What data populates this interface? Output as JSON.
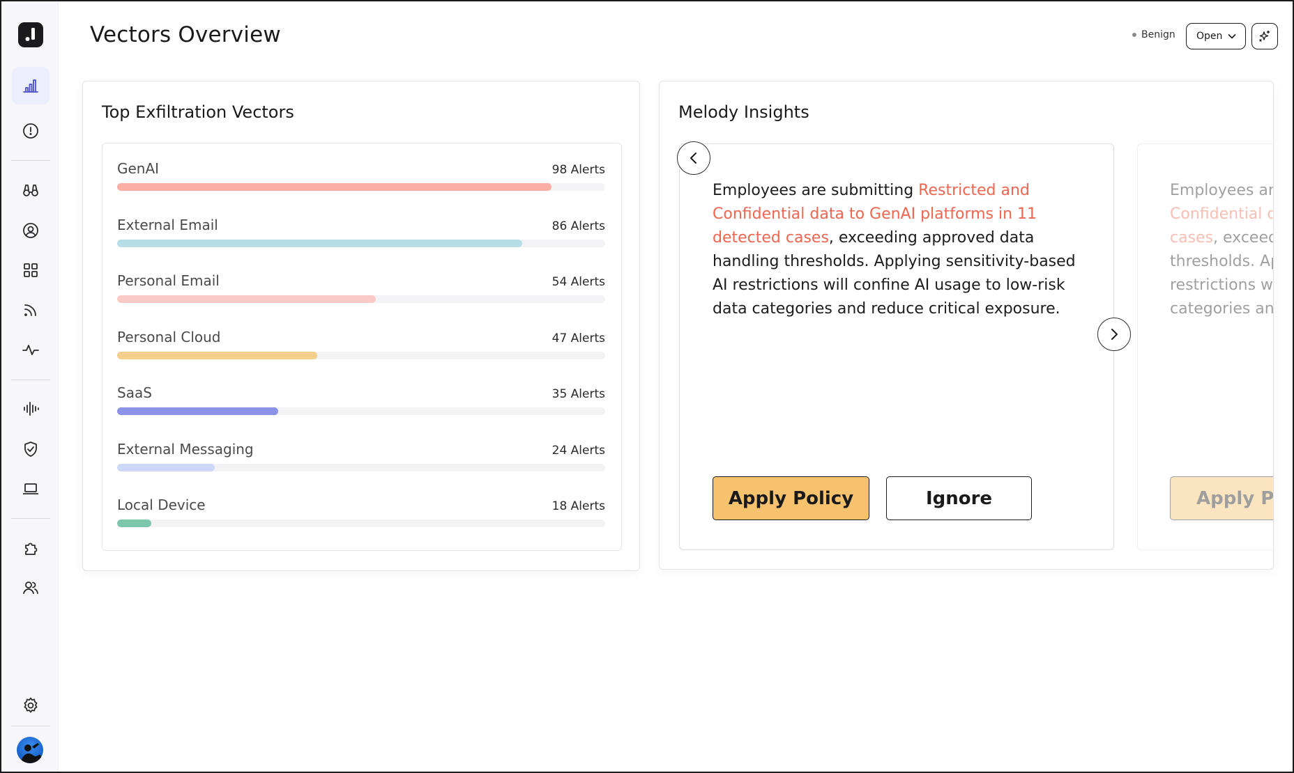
{
  "header": {
    "title": "Vectors Overview",
    "status_label": "Benign",
    "status_dot_color": "#8a8a8a",
    "open_select_value": "Open"
  },
  "sidebar": {
    "items": [
      {
        "icon": "bar-chart-icon",
        "active": true
      },
      {
        "icon": "alert-circle-icon",
        "active": false
      },
      {
        "icon": "binoculars-icon",
        "active": false
      },
      {
        "icon": "user-circle-icon",
        "active": false
      },
      {
        "icon": "grid-icon",
        "active": false
      },
      {
        "icon": "feed-icon",
        "active": false
      },
      {
        "icon": "activity-icon",
        "active": false
      },
      {
        "icon": "waveform-icon",
        "active": false
      },
      {
        "icon": "shield-check-icon",
        "active": false
      },
      {
        "icon": "laptop-icon",
        "active": false
      },
      {
        "icon": "puzzle-icon",
        "active": false
      },
      {
        "icon": "users-icon",
        "active": false
      },
      {
        "icon": "gear-icon",
        "active": false
      }
    ]
  },
  "vectors": {
    "title": "Top Exfiltration Vectors",
    "max_alerts": 98,
    "items": [
      {
        "name": "GenAI",
        "count": 98,
        "count_label": "98 Alerts",
        "color": "#fbaea6",
        "fill_fraction": 0.89
      },
      {
        "name": "External Email",
        "count": 86,
        "count_label": "86 Alerts",
        "color": "#b7dde6",
        "fill_fraction": 0.83
      },
      {
        "name": "Personal Email",
        "count": 54,
        "count_label": "54 Alerts",
        "color": "#fbc9c6",
        "fill_fraction": 0.53
      },
      {
        "name": "Personal Cloud",
        "count": 47,
        "count_label": "47 Alerts",
        "color": "#f4cf8c",
        "fill_fraction": 0.41
      },
      {
        "name": "SaaS",
        "count": 35,
        "count_label": "35 Alerts",
        "color": "#8c92e8",
        "fill_fraction": 0.33
      },
      {
        "name": "External Messaging",
        "count": 24,
        "count_label": "24 Alerts",
        "color": "#cdd8f8",
        "fill_fraction": 0.2
      },
      {
        "name": "Local Device",
        "count": 18,
        "count_label": "18 Alerts",
        "color": "#7cc7ab",
        "fill_fraction": 0.07
      }
    ]
  },
  "insights": {
    "title": "Melody Insights",
    "cards": [
      {
        "text_before": "Employees are submitting ",
        "text_highlight": "Restricted and Confidential data to GenAI platforms in 11 detected cases",
        "text_after": ", exceeding approved data handling thresholds. Applying sensitivity-based AI restrictions will confine AI usage to low-risk data categories and reduce critical exposure.",
        "apply_label": "Apply Policy",
        "ignore_label": "Ignore"
      },
      {
        "text_before": "Employees are",
        "text_highlight": "Confidential da",
        "text_highlight_2": "cases",
        "text_after_1": ", exceedi",
        "text_line4": "thresholds. Ap",
        "text_line5": "restrictions wi",
        "text_line6": "categories and",
        "apply_label": "Apply Pol"
      }
    ],
    "highlight_color": "#f0654f",
    "apply_color": "#f6c26e"
  }
}
